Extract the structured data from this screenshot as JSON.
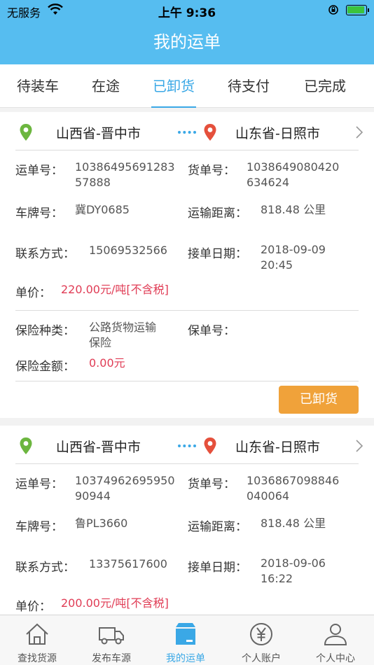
{
  "status_bar": {
    "carrier": "无服务",
    "time": "上午 9:36"
  },
  "header": {
    "title": "我的运单"
  },
  "tabs": [
    {
      "label": "待装车"
    },
    {
      "label": "在途"
    },
    {
      "label": "已卸货"
    },
    {
      "label": "待支付"
    },
    {
      "label": "已完成"
    }
  ],
  "active_tab": 2,
  "labels": {
    "waybill_no": "运单号：",
    "cargo_no": "货单号：",
    "plate": "车牌号：",
    "distance": "运输距离：",
    "contact": "联系方式：",
    "accept_date": "接单日期：",
    "unit_price": "单价：",
    "insurance_type": "保险种类：",
    "policy_no": "保单号：",
    "insurance_amount": "保险金额："
  },
  "orders": [
    {
      "origin": "山西省-晋中市",
      "destination": "山东省-日照市",
      "waybill_no_1": "10386495691283",
      "waybill_no_2": "57888",
      "cargo_no_1": "1038649080420",
      "cargo_no_2": "634624",
      "plate": "冀DY0685",
      "distance": "818.48 公里",
      "contact": "15069532566",
      "accept_date_1": "2018-09-09",
      "accept_date_2": "20:45",
      "unit_price": "220.00元/吨[不含税]",
      "insurance_type_1": "公路货物运输",
      "insurance_type_2": "保险",
      "policy_no": "",
      "insurance_amount": "0.00元",
      "status_button": "已卸货"
    },
    {
      "origin": "山西省-晋中市",
      "destination": "山东省-日照市",
      "waybill_no_1": "10374962695950",
      "waybill_no_2": "90944",
      "cargo_no_1": "1036867098846",
      "cargo_no_2": "040064",
      "plate": "鲁PL3660",
      "distance": "818.48 公里",
      "contact": "13375617600",
      "accept_date_1": "2018-09-06",
      "accept_date_2": "16:22",
      "unit_price": "200.00元/吨[不含税]"
    }
  ],
  "bottom_nav": [
    {
      "label": "查找货源",
      "icon": "home-icon"
    },
    {
      "label": "发布车源",
      "icon": "truck-icon"
    },
    {
      "label": "我的运单",
      "icon": "waybill-box-icon"
    },
    {
      "label": "个人账户",
      "icon": "yuan-coin-icon"
    },
    {
      "label": "个人中心",
      "icon": "user-icon"
    }
  ],
  "colors": {
    "primary": "#56bdf0",
    "accent": "#3aa8e6",
    "price_red": "#e03c55",
    "status_orange": "#f0a23a",
    "origin_pin": "#6cb63f",
    "destination_pin": "#e5503c"
  }
}
